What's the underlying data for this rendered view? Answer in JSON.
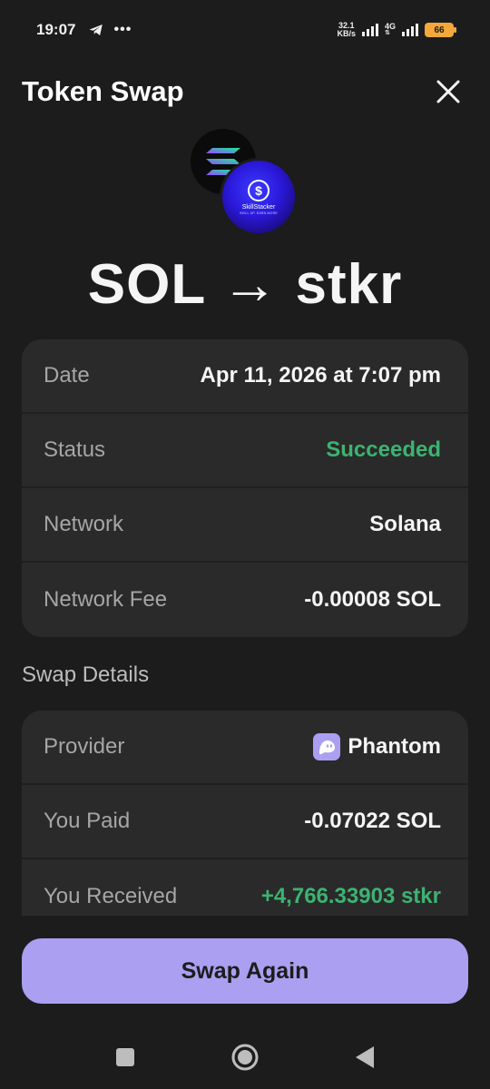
{
  "status_bar": {
    "time": "19:07",
    "overflow": "•••",
    "net_speed_value": "32.1",
    "net_speed_unit": "KB/s",
    "network_type": "4G",
    "battery": "66",
    "telegram_icon": "telegram-icon",
    "signal_icon": "signal-bars-icon"
  },
  "header": {
    "title": "Token Swap",
    "close_icon": "close-icon"
  },
  "tokens": {
    "from_logo": "solana-logo-icon",
    "to_logo_brand": "SkillStacker",
    "to_logo_tagline": "SKILL UP. EARN MORE",
    "to_logo_symbol": "$",
    "pair": "SOL → stkr"
  },
  "summary": [
    {
      "label": "Date",
      "value": "Apr 11, 2026 at 7:07 pm"
    },
    {
      "label": "Status",
      "value": "Succeeded"
    },
    {
      "label": "Network",
      "value": "Solana"
    },
    {
      "label": "Network Fee",
      "value": "-0.00008 SOL"
    }
  ],
  "swap_details": {
    "section_title": "Swap Details",
    "rows": [
      {
        "label": "Provider",
        "value": "Phantom",
        "icon": "phantom-ghost-icon"
      },
      {
        "label": "You Paid",
        "value": "-0.07022 SOL"
      },
      {
        "label": "You Received",
        "value": "+4,766.33903 stkr"
      }
    ]
  },
  "actions": {
    "swap_again": "Swap Again"
  },
  "nav": {
    "recents": "square-icon",
    "home": "circle-home-icon",
    "back": "triangle-back-icon"
  },
  "colors": {
    "background": "#1c1c1c",
    "card": "#2a2a2a",
    "accent": "#ab9ff2",
    "success": "#3cb371",
    "muted_text": "#a6a6a6"
  }
}
